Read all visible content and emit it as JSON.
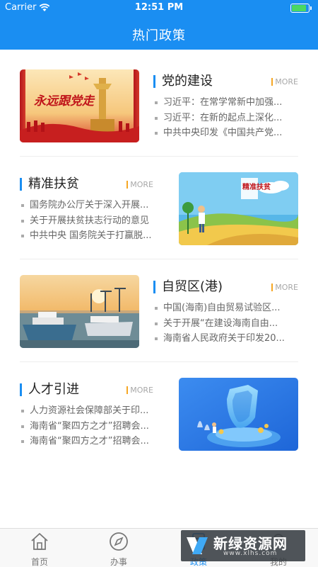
{
  "status_bar": {
    "carrier": "Carrier",
    "time": "12:51 PM"
  },
  "header": {
    "title": "热门政策"
  },
  "sections": [
    {
      "title": "党的建设",
      "more": "MORE",
      "image_icon": "great-hall-celebration-image",
      "image_caption": "永远跟党走",
      "items": [
        "习近平：在常学常新中加强...",
        "习近平：在新的起点上深化...",
        "中共中央印发《中国共产党..."
      ]
    },
    {
      "title": "精准扶贫",
      "more": "MORE",
      "image_icon": "poverty-alleviation-image",
      "image_caption": "精准扶贫",
      "items": [
        "国务院办公厅关于深入开展...",
        "关于开展扶贫扶志行动的意见",
        "中共中央 国务院关于打赢脱..."
      ]
    },
    {
      "title": "自贸区(港)",
      "more": "MORE",
      "image_icon": "harbor-image",
      "items": [
        "中国(海南)自由贸易试验区...",
        "关于开展“在建设海南自由...",
        "海南省人民政府关于印发20..."
      ]
    },
    {
      "title": "人才引进",
      "more": "MORE",
      "image_icon": "talent-shield-image",
      "items": [
        "人力资源社会保障部关于印...",
        "海南省“聚四方之才”招聘会...",
        "海南省“聚四方之才”招聘会..."
      ]
    }
  ],
  "tabbar": {
    "items": [
      {
        "label": "首页",
        "icon": "home-icon",
        "active": false
      },
      {
        "label": "办事",
        "icon": "compass-icon",
        "active": false
      },
      {
        "label": "政策",
        "icon": "policy-icon",
        "active": true
      },
      {
        "label": "我的",
        "icon": "user-icon",
        "active": false
      }
    ]
  },
  "watermark": {
    "name": "新绿资源网",
    "url": "www.xlhs.com"
  },
  "colors": {
    "primary": "#1a8ef2",
    "accent": "#f5a623",
    "battery": "#4ad863"
  }
}
